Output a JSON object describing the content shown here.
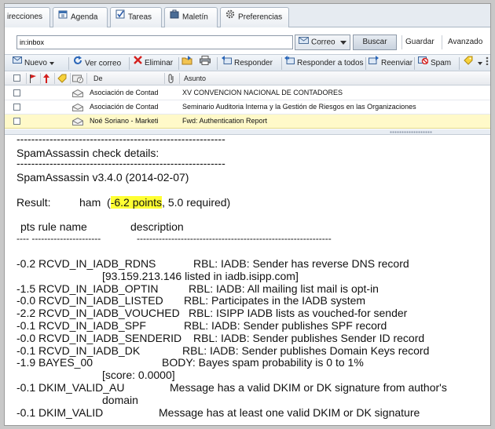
{
  "tabs": [
    {
      "label": "irecciones",
      "icon": "address-book-icon"
    },
    {
      "label": "Agenda",
      "icon": "calendar-icon"
    },
    {
      "label": "Tareas",
      "icon": "checkbox-icon"
    },
    {
      "label": "Maletín",
      "icon": "briefcase-icon"
    },
    {
      "label": "Preferencias",
      "icon": "gear-icon"
    }
  ],
  "search": {
    "value": "in:inbox",
    "scope": "Correo",
    "button": "Buscar",
    "save": "Guardar",
    "advanced": "Avanzado"
  },
  "toolbar": {
    "new": "Nuevo",
    "check_mail": "Ver correo",
    "delete": "Eliminar",
    "reply": "Responder",
    "reply_all": "Responder a todos",
    "forward": "Reenviar",
    "spam": "Spam"
  },
  "list": {
    "col_from": "De",
    "col_subject": "Asunto",
    "rows": [
      {
        "from": "Asociación de Contad",
        "subject": "XV CONVENCION NACIONAL DE CONTADORES",
        "selected": false
      },
      {
        "from": "Asociación de Contad",
        "subject": "Seminario Auditoria Interna y la Gestión de Riesgos en las Organizaciones",
        "selected": false
      },
      {
        "from": "Noé Soriano - Marketi",
        "subject": "Fwd: Authentication Report",
        "selected": true
      }
    ]
  },
  "message": {
    "divider_long": "---------------------------------------------------------",
    "check_title": "SpamAssassin check details:",
    "version": "SpamAssassin v3.4.0 (2014-02-07)",
    "result_label": "Result:",
    "result_value": "ham",
    "result_points": "-6.2 points",
    "result_required": ", 5.0 required)",
    "col_header": "pts rule name",
    "col_header_desc": "description",
    "col_dashes_a": "---- ----------------------",
    "col_dashes_b": "--------------------------------------------------------------",
    "rules": [
      {
        "pts": "-0.2",
        "name": "RCVD_IN_IADB_RDNS",
        "desc": "RBL: IADB: Sender has reverse DNS record"
      },
      {
        "pts": "",
        "name": "",
        "desc": "[93.159.213.146 listed in iadb.isipp.com]"
      },
      {
        "pts": "-1.5",
        "name": "RCVD_IN_IADB_OPTIN",
        "desc": "RBL: IADB: All mailing list mail is opt-in"
      },
      {
        "pts": "-0.0",
        "name": "RCVD_IN_IADB_LISTED",
        "desc": "RBL: Participates in the IADB system"
      },
      {
        "pts": "-2.2",
        "name": "RCVD_IN_IADB_VOUCHED",
        "desc": "RBL: ISIPP IADB lists as vouched-for sender"
      },
      {
        "pts": "-0.1",
        "name": "RCVD_IN_IADB_SPF",
        "desc": "RBL: IADB: Sender publishes SPF record"
      },
      {
        "pts": "-0.0",
        "name": "RCVD_IN_IADB_SENDERID",
        "desc": "RBL: IADB: Sender publishes Sender ID record"
      },
      {
        "pts": "-0.1",
        "name": "RCVD_IN_IADB_DK",
        "desc": "RBL: IADB: Sender publishes Domain Keys record"
      },
      {
        "pts": "-1.9",
        "name": "BAYES_00",
        "desc": "BODY: Bayes spam probability is 0 to 1%"
      },
      {
        "pts": "",
        "name": "",
        "desc": "[score: 0.0000]"
      },
      {
        "pts": "-0.1",
        "name": "DKIM_VALID_AU",
        "desc": "Message has a valid DKIM or DK signature from author's"
      },
      {
        "pts": "",
        "name": "",
        "desc": "domain"
      },
      {
        "pts": "-0.1",
        "name": "DKIM_VALID",
        "desc": "Message has at least one valid DKIM or DK signature"
      }
    ]
  },
  "colors": {
    "highlight": "#ffff33",
    "selected_row": "#fff9c9",
    "tab_bg": "#e6ebf1"
  }
}
